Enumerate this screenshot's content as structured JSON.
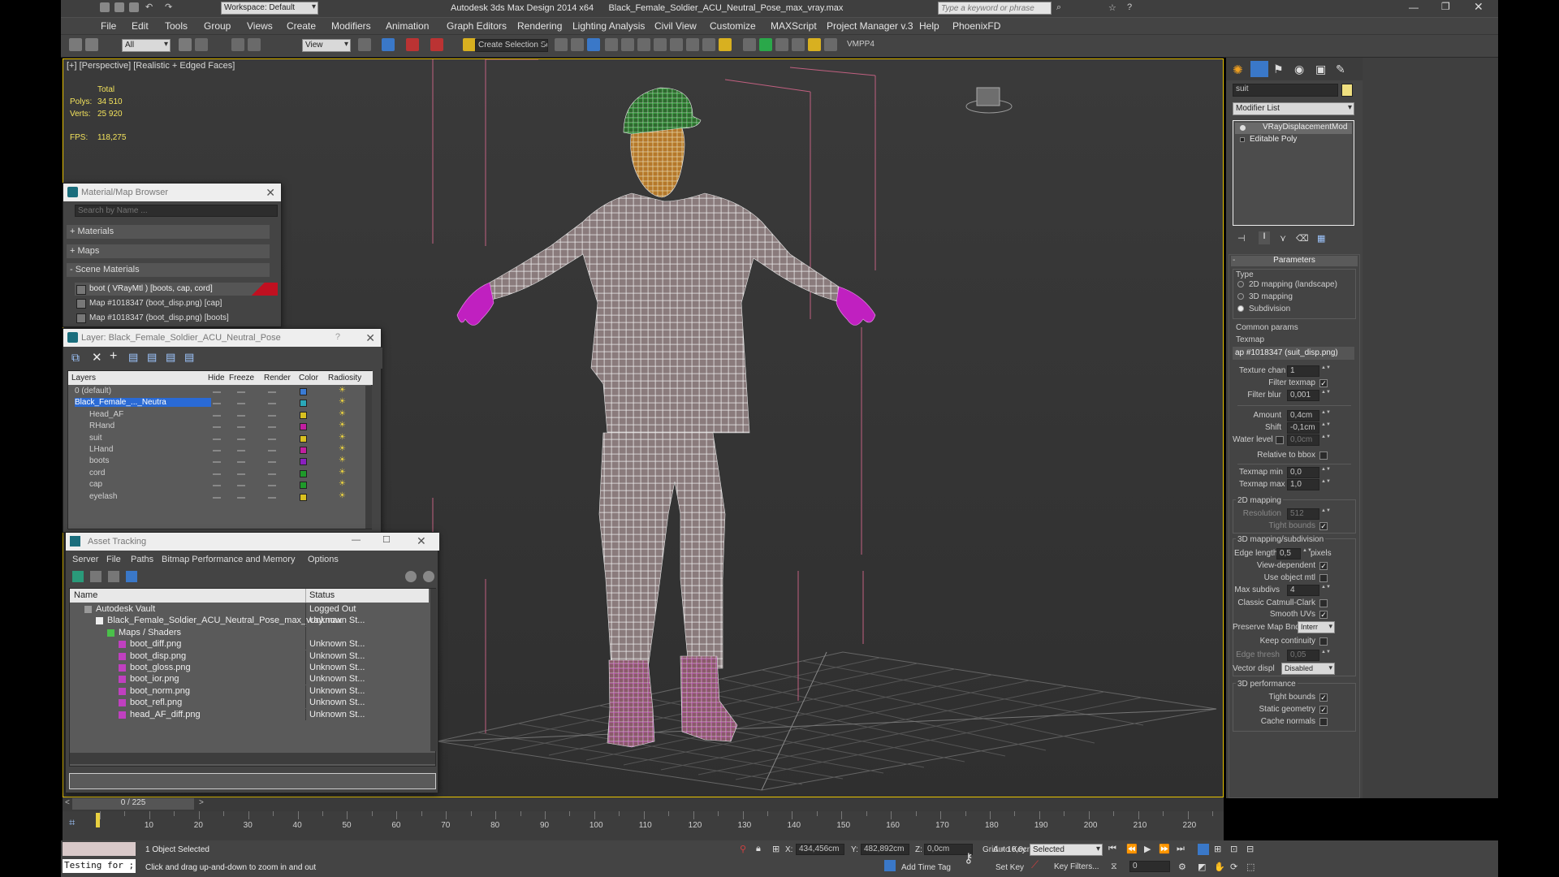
{
  "titlebar": {
    "workspace": "Workspace: Default",
    "title": "Autodesk 3ds Max Design 2014 x64      Black_Female_Soldier_ACU_Neutral_Pose_max_vray.max",
    "search_placeholder": "Type a keyword or phrase"
  },
  "menu": [
    "File",
    "Edit",
    "Tools",
    "Group",
    "Views",
    "Create",
    "Modifiers",
    "Animation",
    "Graph Editors",
    "Rendering",
    "Lighting Analysis",
    "Civil View",
    "Customize",
    "MAXScript",
    "Project Manager v.3",
    "Help",
    "PhoenixFD"
  ],
  "toolbar": {
    "selection_filter": "All",
    "ref_coord": "View",
    "named_selection": "Create Selection Se",
    "vmpp": "VMPP4"
  },
  "viewport": {
    "label": "[+] [Perspective] [Realistic + Edged Faces]",
    "stats": {
      "total_label": "Total",
      "polys_label": "Polys:",
      "polys": "34 510",
      "verts_label": "Verts:",
      "verts": "25 920",
      "fps_label": "FPS:",
      "fps": "118,275"
    }
  },
  "material_browser": {
    "title": "Material/Map Browser",
    "search_placeholder": "Search by Name ...",
    "sections": [
      "+ Materials",
      "+ Maps",
      "- Scene Materials"
    ],
    "items": [
      "boot ( VRayMtl ) [boots, cap, cord]",
      "Map #1018347 (boot_disp.png) [cap]",
      "Map #1018347 (boot_disp.png) [boots]"
    ]
  },
  "layer_window": {
    "title": "Layer: Black_Female_Soldier_ACU_Neutral_Pose",
    "help": "?",
    "columns": [
      "Layers",
      "Hide",
      "Freeze",
      "Render",
      "Color",
      "Radiosity"
    ],
    "rows": [
      {
        "name": "0 (default)",
        "color": "#3a7bd5"
      },
      {
        "name": "Black_Female_..._Neutra",
        "color": "#2aa8b8",
        "selected": true
      },
      {
        "name": "Head_AF",
        "color": "#d8c020"
      },
      {
        "name": "RHand",
        "color": "#c21fa0"
      },
      {
        "name": "suit",
        "color": "#d8c020"
      },
      {
        "name": "LHand",
        "color": "#c21fa0"
      },
      {
        "name": "boots",
        "color": "#8a20c0"
      },
      {
        "name": "cord",
        "color": "#1f9a2a"
      },
      {
        "name": "cap",
        "color": "#1f9a2a"
      },
      {
        "name": "eyelash",
        "color": "#d8c020"
      }
    ]
  },
  "asset_tracking": {
    "title": "Asset Tracking",
    "menu": [
      "Server",
      "File",
      "Paths",
      "Bitmap Performance and Memory",
      "Options"
    ],
    "columns": [
      "Name",
      "Status"
    ],
    "rows": [
      {
        "name": "Autodesk Vault",
        "status": "Logged Out",
        "indent": 0
      },
      {
        "name": "Black_Female_Soldier_ACU_Neutral_Pose_max_vray.max",
        "status": "Unknown St...",
        "indent": 1
      },
      {
        "name": "Maps / Shaders",
        "status": "",
        "indent": 2
      },
      {
        "name": "boot_diff.png",
        "status": "Unknown St...",
        "indent": 3
      },
      {
        "name": "boot_disp.png",
        "status": "Unknown St...",
        "indent": 3
      },
      {
        "name": "boot_gloss.png",
        "status": "Unknown St...",
        "indent": 3
      },
      {
        "name": "boot_ior.png",
        "status": "Unknown St...",
        "indent": 3
      },
      {
        "name": "boot_norm.png",
        "status": "Unknown St...",
        "indent": 3
      },
      {
        "name": "boot_refl.png",
        "status": "Unknown St...",
        "indent": 3
      },
      {
        "name": "head_AF_diff.png",
        "status": "Unknown St...",
        "indent": 3
      }
    ]
  },
  "command_panel": {
    "object_name": "suit",
    "modifier_list": "Modifier List",
    "stack": [
      "VRayDisplacementMod",
      "Editable Poly"
    ],
    "parameters_title": "Parameters",
    "type_label": "Type",
    "type_options": [
      "2D mapping (landscape)",
      "3D mapping",
      "Subdivision"
    ],
    "common_params": "Common params",
    "texmap_label": "Texmap",
    "texmap": "ap #1018347 (suit_disp.png)",
    "texture_chan_label": "Texture chan",
    "texture_chan": "1",
    "filter_texmap_label": "Filter texmap",
    "filter_blur_label": "Filter blur",
    "filter_blur": "0,001",
    "amount_label": "Amount",
    "amount": "0,4cm",
    "shift_label": "Shift",
    "shift": "-0,1cm",
    "water_level_label": "Water level",
    "water_level": "0,0cm",
    "relative_bbox_label": "Relative to bbox",
    "texmap_min_label": "Texmap min",
    "texmap_min": "0,0",
    "texmap_max_label": "Texmap max",
    "texmap_max": "1,0",
    "mapping2d_title": "2D mapping",
    "resolution_label": "Resolution",
    "resolution": "512",
    "tight_bounds_label": "Tight bounds",
    "mapping3d_title": "3D mapping/subdivision",
    "edge_length_label": "Edge length",
    "edge_length": "0,5",
    "pixels_label": "pixels",
    "view_dependent_label": "View-dependent",
    "use_object_mtl_label": "Use object mtl",
    "max_subdivs_label": "Max subdivs",
    "max_subdivs": "4",
    "classic_catmull_label": "Classic Catmull-Clark",
    "smooth_uvs_label": "Smooth UVs",
    "preserve_map_label": "Preserve Map Bnd",
    "preserve_map": "Interr",
    "keep_continuity_label": "Keep continuity",
    "edge_thresh_label": "Edge thresh",
    "edge_thresh": "0,05",
    "vector_disp_label": "Vector displ",
    "vector_disp": "Disabled",
    "perf_title": "3D performance",
    "perf_tight_bounds_label": "Tight bounds",
    "static_geometry_label": "Static geometry",
    "cache_normals_label": "Cache normals"
  },
  "timeline": {
    "frame_counter": "0 / 225",
    "ticks": [
      "10",
      "20",
      "30",
      "40",
      "50",
      "60",
      "70",
      "80",
      "90",
      "100",
      "110",
      "120",
      "130",
      "140",
      "150",
      "160",
      "170",
      "180",
      "190",
      "200",
      "210",
      "220"
    ]
  },
  "statusbar": {
    "maxscript_text": "Testing for ;",
    "selected": "1 Object Selected",
    "prompt": "Click and drag up-and-down to zoom in and out",
    "x_label": "X:",
    "x": "434,456cm",
    "y_label": "Y:",
    "y": "482,892cm",
    "z_label": "Z:",
    "z": "0,0cm",
    "grid": "Grid = 10,0cm",
    "add_time_tag": "Add Time Tag",
    "auto_key": "Auto Key",
    "set_key": "Set Key",
    "selected_dropdown": "Selected",
    "key_filters": "Key Filters...",
    "frame": "0"
  }
}
